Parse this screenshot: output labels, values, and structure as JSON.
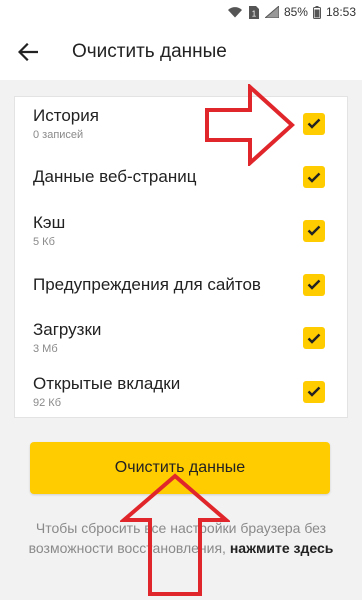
{
  "status_bar": {
    "battery": "85%",
    "time": "18:53",
    "sim_badge": "1",
    "icons": [
      "wifi-icon",
      "sim-icon",
      "signal-icon",
      "battery-icon"
    ]
  },
  "header": {
    "title": "Очистить данные",
    "back_icon": "arrow-left-icon"
  },
  "options": [
    {
      "label": "История",
      "sub": "0 записей",
      "checked": true
    },
    {
      "label": "Данные веб-страниц",
      "sub": "",
      "checked": true
    },
    {
      "label": "Кэш",
      "sub": "5 Кб",
      "checked": true
    },
    {
      "label": "Предупреждения для сайтов",
      "sub": "",
      "checked": true
    },
    {
      "label": "Загрузки",
      "sub": "3 Мб",
      "checked": true
    },
    {
      "label": "Открытые вкладки",
      "sub": "92 Кб",
      "checked": true
    }
  ],
  "clear_button": {
    "label": "Очистить данные"
  },
  "footer": {
    "text_line1": "Чтобы сбросить все настройки браузера без",
    "text_line2": "возможности восстановления, ",
    "link": "нажмите здесь"
  },
  "colors": {
    "accent": "#ffcc00",
    "annotation_arrow": "#e0262b",
    "background": "#f2f2f2",
    "card": "#ffffff"
  }
}
